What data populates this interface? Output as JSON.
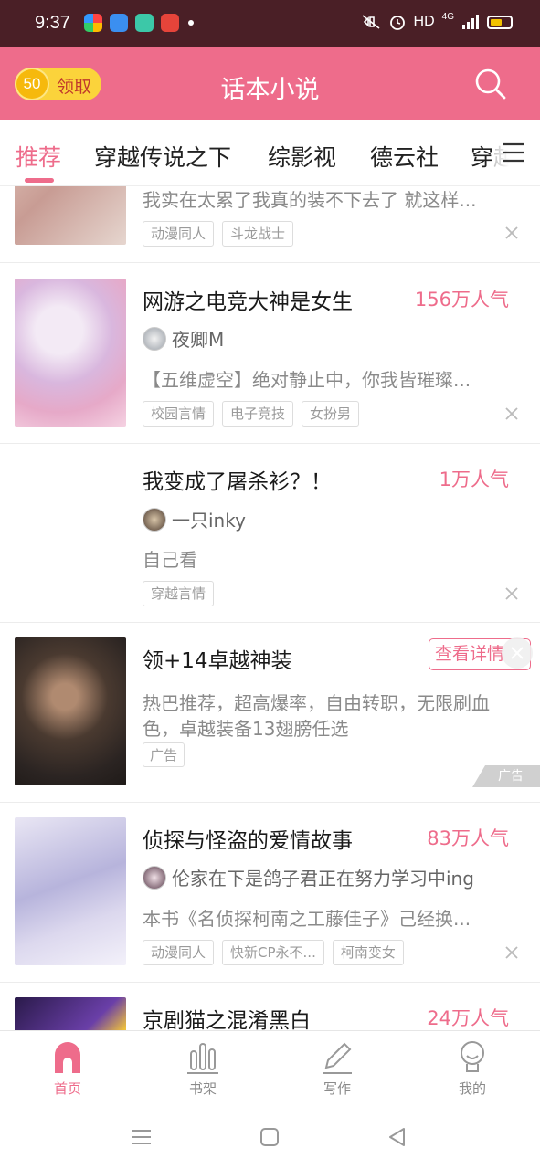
{
  "status_bar": {
    "time": "9:37",
    "network": "HD",
    "signal": "4G",
    "app_icons": [
      "photos-app-icon",
      "cloud-app-icon",
      "store-app-icon",
      "game-app-icon"
    ]
  },
  "header": {
    "reward_count": "50",
    "reward_label": "领取",
    "title": "话本小说",
    "icon": "search-icon"
  },
  "tabs": [
    {
      "label": "推荐",
      "active": true
    },
    {
      "label": "穿越传说之下",
      "active": false
    },
    {
      "label": "综影视",
      "active": false
    },
    {
      "label": "德云社",
      "active": false
    },
    {
      "label": "穿越",
      "active": false
    }
  ],
  "feed": {
    "card0": {
      "desc": "我实在太累了我真的装不下去了 就这样...",
      "tags": [
        "动漫同人",
        "斗龙战士"
      ]
    },
    "card1": {
      "title": "网游之电竞大神是女生",
      "popularity": "156万人气",
      "author": "夜卿M",
      "desc": "【五维虚空】绝对静止中，你我皆璀璨...",
      "tags": [
        "校园言情",
        "电子竞技",
        "女扮男"
      ]
    },
    "card2": {
      "title": "我变成了屠杀衫？！",
      "popularity": "1万人气",
      "author": "一只inky",
      "desc": "自己看",
      "tags": [
        "穿越言情"
      ]
    },
    "ad": {
      "title": "领+14卓越神装",
      "button": "查看详情",
      "desc": "热巴推荐，超高爆率，自由转职，无限刷血色，卓越装备13翅膀任选",
      "tag": "广告",
      "mark": "广告"
    },
    "card4": {
      "title": "侦探与怪盗的爱情故事",
      "popularity": "83万人气",
      "author": "伦家在下是鸽子君正在努力学习中ing",
      "desc": "本书《名侦探柯南之工藤佳子》己经换...",
      "tags": [
        "动漫同人",
        "快新CP永不...",
        "柯南变女"
      ]
    },
    "card5": {
      "title": "京剧猫之混淆黑白",
      "popularity": "24万人气"
    }
  },
  "bottom_nav": [
    {
      "label": "首页",
      "icon": "home-icon",
      "active": true
    },
    {
      "label": "书架",
      "icon": "bookshelf-icon",
      "active": false
    },
    {
      "label": "写作",
      "icon": "pen-icon",
      "active": false
    },
    {
      "label": "我的",
      "icon": "profile-icon",
      "active": false
    }
  ],
  "colors": {
    "accent": "#ee6c8b",
    "status_bar": "#4a1f26",
    "coin": "#fbd33b"
  }
}
